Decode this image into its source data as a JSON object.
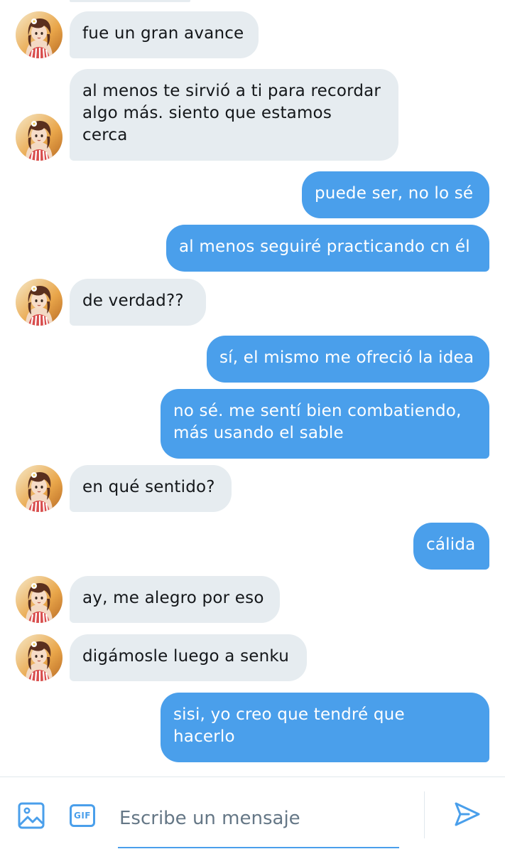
{
  "messages": [
    {
      "side": "in",
      "text": "fue un gran avance"
    },
    {
      "side": "in",
      "text": "al menos te sirvió a ti para recordar\nalgo más. siento que estamos\ncerca"
    },
    {
      "side": "out",
      "text": "puede ser, no lo sé"
    },
    {
      "side": "out",
      "text": "al menos seguiré practicando cn él"
    },
    {
      "side": "in",
      "text": "de verdad??"
    },
    {
      "side": "out",
      "text": "sí, el mismo me ofreció la idea"
    },
    {
      "side": "out",
      "text": "no sé. me sentí bien combatiendo,\nmás usando el sable"
    },
    {
      "side": "in",
      "text": "en qué sentido?"
    },
    {
      "side": "out",
      "text": "cálida"
    },
    {
      "side": "in",
      "text": "ay, me alegro por eso"
    },
    {
      "side": "in",
      "text": "digámosle luego a senku"
    },
    {
      "side": "out",
      "text": "sisi, yo creo que tendré que\nhacerlo"
    }
  ],
  "composer": {
    "placeholder": "Escribe un mensaje",
    "media_icon": "image-icon",
    "gif_label": "GIF",
    "send_icon": "send-icon"
  },
  "colors": {
    "outgoing": "#4a9feb",
    "incoming": "#e6ecf0",
    "accent": "#4a9feb"
  }
}
